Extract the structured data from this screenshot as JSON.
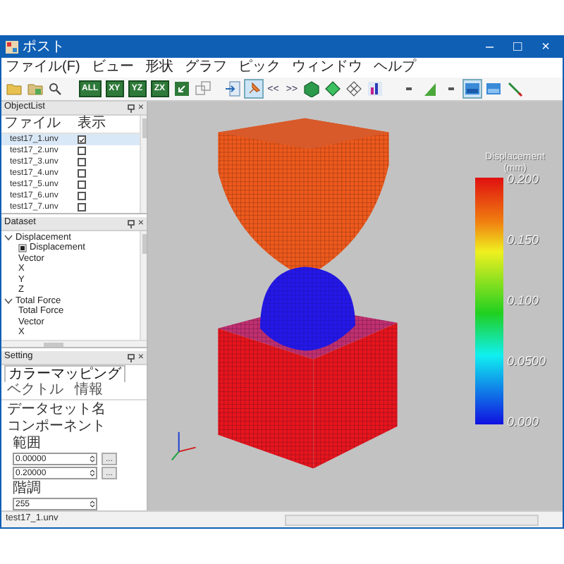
{
  "window": {
    "title": "ポスト",
    "controls": [
      "–",
      "□",
      "×"
    ]
  },
  "menu": [
    "ファイル(F)",
    "ビュー",
    "形状",
    "グラフ",
    "ピック",
    "ウィンドウ",
    "ヘルプ"
  ],
  "toolbar": {
    "view_buttons": [
      "ALL",
      "XY",
      "YZ",
      "ZX"
    ],
    "pin": {
      "selected": true
    },
    "nav_buttons": [
      "<<",
      ">>"
    ],
    "display_modes": [
      {
        "selected": true
      },
      {
        "selected": false
      }
    ]
  },
  "object_list": {
    "title": "ObjectList",
    "close": "×",
    "columns": [
      "ファイル",
      "表示"
    ],
    "rows": [
      {
        "file": "test17_1.unv",
        "checked": true,
        "selected": true
      },
      {
        "file": "test17_2.unv",
        "checked": false,
        "selected": false
      },
      {
        "file": "test17_3.unv",
        "checked": false,
        "selected": false
      },
      {
        "file": "test17_4.unv",
        "checked": false,
        "selected": false
      },
      {
        "file": "test17_5.unv",
        "checked": false,
        "selected": false
      },
      {
        "file": "test17_6.unv",
        "checked": false,
        "selected": false
      },
      {
        "file": "test17_7.unv",
        "checked": false,
        "selected": false
      }
    ]
  },
  "dataset": {
    "title": "Dataset",
    "close": "×",
    "tree": [
      {
        "label": "Displacement",
        "expanded": true,
        "children": [
          {
            "label": "Displacement",
            "shown": true
          },
          {
            "label": "Vector",
            "shown": false
          },
          {
            "label": "X",
            "shown": false
          },
          {
            "label": "Y",
            "shown": false
          },
          {
            "label": "Z",
            "shown": false
          }
        ]
      },
      {
        "label": "Total Force",
        "expanded": true,
        "children": [
          {
            "label": "Total Force",
            "shown": false
          },
          {
            "label": "Vector",
            "shown": false
          },
          {
            "label": "X",
            "shown": false
          }
        ]
      }
    ]
  },
  "setting": {
    "title": "Setting",
    "close": "×",
    "tabs": [
      {
        "label": "カラーマッピング",
        "selected": true
      },
      {
        "label": "ベクトル",
        "selected": false
      },
      {
        "label": "情報",
        "selected": false
      }
    ],
    "dataset_name_label": "データセット名",
    "component_label": "コンポーネント",
    "range": {
      "label": "範囲",
      "fields": [
        {
          "value": "0.00000",
          "button": "..."
        },
        {
          "value": "0.20000",
          "button": "..."
        }
      ]
    },
    "steps": {
      "label": "階調",
      "value": "255"
    }
  },
  "legend": {
    "title": "Displacement",
    "unit": "(mm)",
    "labels": [
      "0.200",
      "0.150",
      "0.100",
      "0.0500",
      "0.000"
    ]
  },
  "status_bar": {
    "text": "test17_1.unv"
  }
}
